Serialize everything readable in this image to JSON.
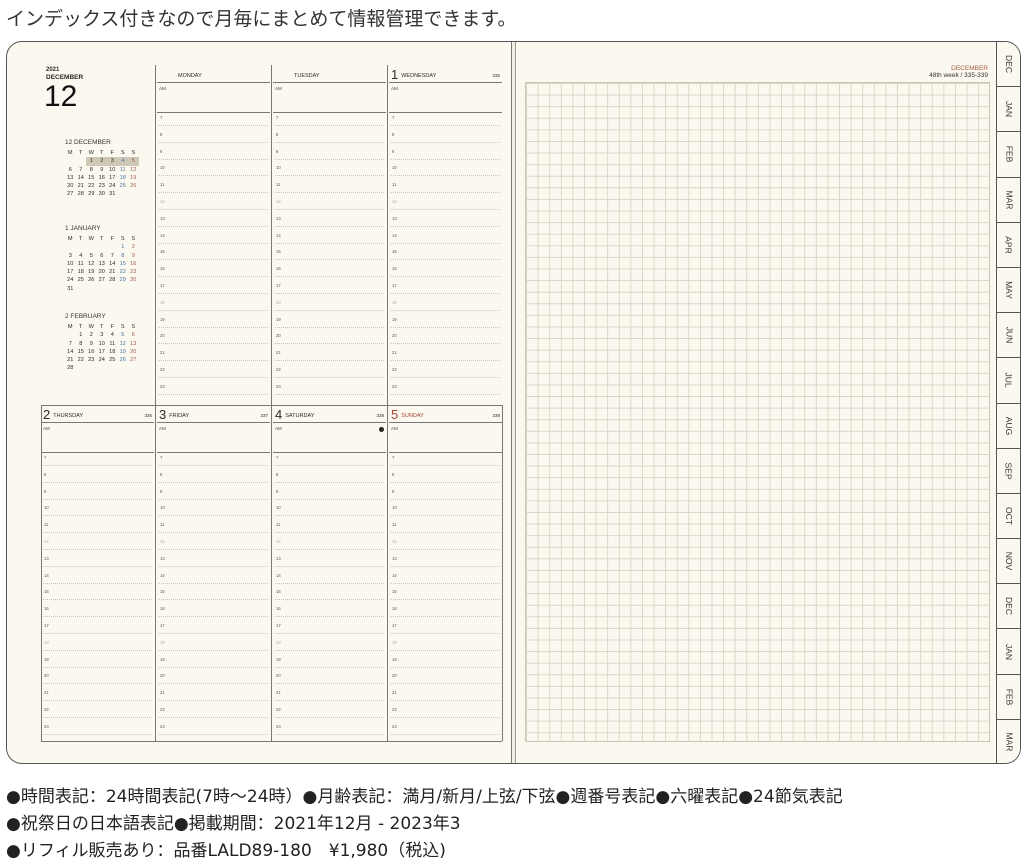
{
  "headline": "インデックス付きなので月毎にまとめて情報管理できます。",
  "planner": {
    "year": "2021",
    "month_name": "DECEMBER",
    "month_number": "12",
    "mini_calendars": [
      {
        "title": "12 DECEMBER",
        "weekdays": [
          "M",
          "T",
          "W",
          "T",
          "F",
          "S",
          "S"
        ],
        "weeks": [
          [
            "",
            "",
            "1",
            "2",
            "3",
            "4",
            "5"
          ],
          [
            "6",
            "7",
            "8",
            "9",
            "10",
            "11",
            "12"
          ],
          [
            "13",
            "14",
            "15",
            "16",
            "17",
            "18",
            "19"
          ],
          [
            "20",
            "21",
            "22",
            "23",
            "24",
            "25",
            "26"
          ],
          [
            "27",
            "28",
            "29",
            "30",
            "31",
            "",
            ""
          ]
        ]
      },
      {
        "title": "1 JANUARY",
        "weekdays": [
          "M",
          "T",
          "W",
          "T",
          "F",
          "S",
          "S"
        ],
        "weeks": [
          [
            "",
            "",
            "",
            "",
            "",
            "1",
            "2"
          ],
          [
            "3",
            "4",
            "5",
            "6",
            "7",
            "8",
            "9"
          ],
          [
            "10",
            "11",
            "12",
            "13",
            "14",
            "15",
            "16"
          ],
          [
            "17",
            "18",
            "19",
            "20",
            "21",
            "22",
            "23"
          ],
          [
            "24",
            "25",
            "26",
            "27",
            "28",
            "29",
            "30"
          ],
          [
            "31",
            "",
            "",
            "",
            "",
            "",
            ""
          ]
        ]
      },
      {
        "title": "2 FEBRUARY",
        "weekdays": [
          "M",
          "T",
          "W",
          "T",
          "F",
          "S",
          "S"
        ],
        "weeks": [
          [
            "",
            "1",
            "2",
            "3",
            "4",
            "5",
            "6"
          ],
          [
            "7",
            "8",
            "9",
            "10",
            "11",
            "12",
            "13"
          ],
          [
            "14",
            "15",
            "16",
            "17",
            "18",
            "19",
            "20"
          ],
          [
            "21",
            "22",
            "23",
            "24",
            "25",
            "26",
            "27"
          ],
          [
            "28",
            "",
            "",
            "",
            "",
            "",
            ""
          ]
        ]
      }
    ],
    "top_days": [
      {
        "num": "",
        "name": "MONDAY",
        "week_no": ""
      },
      {
        "num": "",
        "name": "TUESDAY",
        "week_no": ""
      },
      {
        "num": "1",
        "name": "WEDNESDAY",
        "week_no": "335"
      }
    ],
    "bottom_days": [
      {
        "num": "2",
        "name": "THURSDAY",
        "week_no": "336"
      },
      {
        "num": "3",
        "name": "FRIDAY",
        "week_no": "337"
      },
      {
        "num": "4",
        "name": "SATURDAY",
        "week_no": "338"
      },
      {
        "num": "5",
        "name": "SUNDAY",
        "week_no": "339"
      }
    ],
    "am_label": "AM",
    "hours": [
      "7",
      "8",
      "9",
      "10",
      "11",
      "12",
      "13",
      "14",
      "15",
      "16",
      "17",
      "18",
      "19",
      "20",
      "21",
      "22",
      "23"
    ],
    "moon_phase_icon": "new-moon-icon",
    "right_page": {
      "month": "DECEMBER",
      "week_info": "48th week / 335-339"
    },
    "index_tabs": [
      "DEC",
      "JAN",
      "FEB",
      "MAR",
      "APR",
      "MAY",
      "JUN",
      "JUL",
      "AUG",
      "SEP",
      "OCT",
      "NOV",
      "DEC",
      "JAN",
      "FEB",
      "MAR"
    ]
  },
  "specs": [
    "●時間表記：24時間表記(7時～24時）●月齢表記：満月/新月/上弦/下弦●週番号表記●六曜表記●24節気表記",
    "●祝祭日の日本語表記●掲載期間：2021年12月 - 2023年3",
    "●リフィル販売あり：品番LALD89-180　¥1,980（税込)"
  ]
}
